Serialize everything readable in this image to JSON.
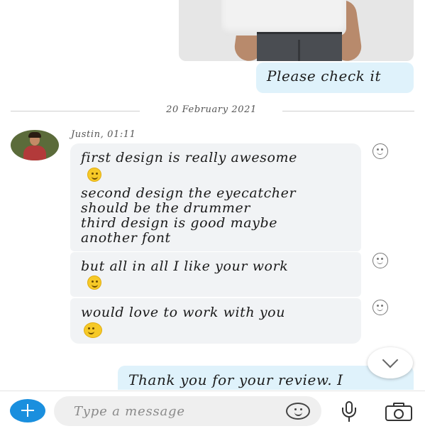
{
  "messages_top": {
    "image_alt": "photo of person in white t-shirt",
    "check_text": "Please check it"
  },
  "date_separator": "20 February 2021",
  "incoming": {
    "sender_label": "Justin, 01:11",
    "bubble1": {
      "line1": "first design is really awesome",
      "line2": "second design the eyecatcher",
      "line3": "should be the drummer",
      "line4": "third design is good maybe",
      "line5": "another font"
    },
    "bubble2": {
      "line1": "but all in all I like your work"
    },
    "bubble3": {
      "line1": "would love to work with you"
    }
  },
  "outgoing_partial": "Thank you for your review. I",
  "composer": {
    "placeholder": "Type a message"
  },
  "icons": {
    "add": "plus-icon",
    "emoji": "smiley-icon",
    "mic": "microphone-icon",
    "camera": "camera-icon",
    "scroll": "chevron-down-icon",
    "react": "smiley-outline-icon"
  },
  "colors": {
    "accent": "#1a8fde",
    "outgoing_bubble": "#dff2fb",
    "incoming_bubble": "#f1f3f5"
  }
}
